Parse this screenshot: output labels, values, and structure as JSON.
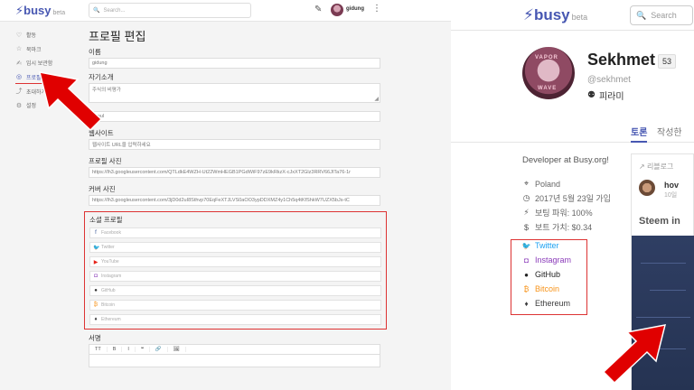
{
  "left": {
    "logo": {
      "name": "busy",
      "beta": "beta"
    },
    "search": {
      "placeholder": "Search..."
    },
    "username": "gidung",
    "sidebar": {
      "items": [
        {
          "label": "활동",
          "icon": "activity-icon"
        },
        {
          "label": "북마크",
          "icon": "star-icon"
        },
        {
          "label": "임시 보관함",
          "icon": "drafts-icon"
        },
        {
          "label": "프로필 편집",
          "icon": "user-circle-icon",
          "active": true
        },
        {
          "label": "초대하기",
          "icon": "share-icon"
        },
        {
          "label": "설정",
          "icon": "gear-icon"
        }
      ]
    },
    "form": {
      "title": "프로필 편집",
      "name_label": "이름",
      "name_value": "gidung",
      "about_label": "자기소개",
      "about_value": "주식의 비평가",
      "location_value": "seoul",
      "website_label": "웹사이트",
      "website_placeholder": "웹사이트 URL을 입력하세요",
      "profile_photo_label": "프로필 사진",
      "profile_photo_value": "https://lh3.googleusercontent.com/QTLdkE4WZH-Ut22WmHEGB1PGdWiF97zE9kRkzX-cJxXT2Glz3RRV66JITa76-1r",
      "cover_photo_label": "커버 사진",
      "cover_photo_value": "https://lh3.googleusercontent.com/3jD0d2uI8Sthvp70EqFeXTJLVS0aOO3ypDDXMZ4y1Ch5q4tKfShkW7UZX5bJs-tC",
      "social_label": "소셜 프로필",
      "social": [
        {
          "placeholder": "Facebook",
          "icon": "facebook-icon",
          "color": "#3b5998"
        },
        {
          "placeholder": "Twitter",
          "icon": "twitter-icon",
          "color": "#1da1f2"
        },
        {
          "placeholder": "YouTube",
          "icon": "youtube-icon",
          "color": "#e62117"
        },
        {
          "placeholder": "Instagram",
          "icon": "instagram-icon",
          "color": "#8a3ab9"
        },
        {
          "placeholder": "GitHub",
          "icon": "github-icon",
          "color": "#333333"
        },
        {
          "placeholder": "Bitcoin",
          "icon": "bitcoin-icon",
          "color": "#f7931a"
        },
        {
          "placeholder": "Ethereum",
          "icon": "ethereum-icon",
          "color": "#3c3c3d"
        }
      ],
      "signature_label": "서명",
      "editor_tools": [
        "TT",
        "B",
        "I",
        "❝",
        "🔗",
        "🖼"
      ]
    }
  },
  "right": {
    "logo": {
      "name": "busy",
      "beta": "beta"
    },
    "search": {
      "placeholder": "Search"
    },
    "profile": {
      "name": "Sekhmet",
      "reputation": "53",
      "handle": "@sekhmet",
      "rank": "피라미",
      "avatar_text_top": "VAPOR",
      "avatar_text_bottom": "WAVE"
    },
    "tabs": {
      "active": "토론",
      "second": "작성한"
    },
    "about": "Developer at Busy.org!",
    "info": [
      {
        "text": "Poland",
        "icon": "location-icon"
      },
      {
        "text": "2017년 5월 23일 가입",
        "icon": "calendar-icon"
      },
      {
        "text": "보팅 파워: 100%",
        "icon": "lightning-icon"
      },
      {
        "text": "보트 가치: $0.34",
        "icon": "dollar-icon"
      }
    ],
    "links": [
      {
        "text": "Twitter",
        "icon": "twitter-icon",
        "color": "#1da1f2"
      },
      {
        "text": "Instagram",
        "icon": "instagram-icon",
        "color": "#8a3ab9"
      },
      {
        "text": "GitHub",
        "icon": "github-icon",
        "color": "#222222"
      },
      {
        "text": "Bitcoin",
        "icon": "bitcoin-icon",
        "color": "#f7931a"
      },
      {
        "text": "Ethereum",
        "icon": "ethereum-icon",
        "color": "#3c3c3d"
      }
    ],
    "feed": {
      "header": "리블로그",
      "author": "hov",
      "time": "10일",
      "title": "Steem in"
    }
  },
  "colors": {
    "accent": "#4757b2",
    "highlight": "#d32f2f",
    "arrow": "#e00000"
  }
}
